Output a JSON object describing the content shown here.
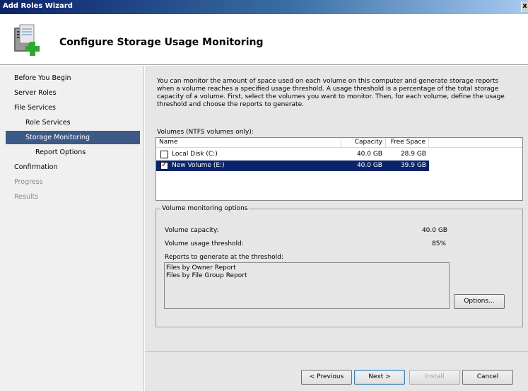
{
  "window": {
    "title": "Add Roles Wizard",
    "close_glyph": "x"
  },
  "header": {
    "title": "Configure Storage Usage Monitoring",
    "icon": "server-add-icon"
  },
  "nav": {
    "items": [
      {
        "label": "Before You Begin",
        "state": "normal"
      },
      {
        "label": "Server Roles",
        "state": "normal"
      },
      {
        "label": "File Services",
        "state": "normal"
      },
      {
        "label": "Role Services",
        "state": "normal"
      },
      {
        "label": "Storage Monitoring",
        "state": "selected"
      },
      {
        "label": "Report Options",
        "state": "normal"
      },
      {
        "label": "Confirmation",
        "state": "normal"
      },
      {
        "label": "Progress",
        "state": "disabled"
      },
      {
        "label": "Results",
        "state": "disabled"
      }
    ]
  },
  "description": "You can monitor the amount of space used on each volume on this computer and generate storage reports when a volume reaches a specified usage threshold.  A usage threshold is a percentage of the total storage capacity of a volume. First, select the volumes you want to monitor.  Then, for each volume, define the usage threshold and choose the reports to generate.",
  "volumes": {
    "label": "Volumes (NTFS volumes only):",
    "columns": {
      "name": "Name",
      "capacity": "Capacity",
      "free": "Free Space"
    },
    "rows": [
      {
        "name": "Local Disk (C:)",
        "capacity": "40.0 GB",
        "free": "28.9 GB",
        "checked": false,
        "selected": false
      },
      {
        "name": "New Volume (E:)",
        "capacity": "40.0 GB",
        "free": "39.9 GB",
        "checked": true,
        "selected": true
      }
    ]
  },
  "monitoring": {
    "legend": "Volume monitoring options",
    "capacity_label": "Volume capacity:",
    "capacity_value": "40.0 GB",
    "threshold_label": "Volume usage threshold:",
    "threshold_value": "85%",
    "reports_label": "Reports to generate at the threshold:",
    "reports": [
      "Files by Owner Report",
      "Files by File Group Report"
    ],
    "options_button": "Options..."
  },
  "buttons": {
    "previous": "< Previous",
    "next": "Next >",
    "install": "Install",
    "cancel": "Cancel"
  },
  "colors": {
    "selection": "#0a246a",
    "nav_selection": "#3d5a86",
    "titlebar": "#0a246a"
  }
}
